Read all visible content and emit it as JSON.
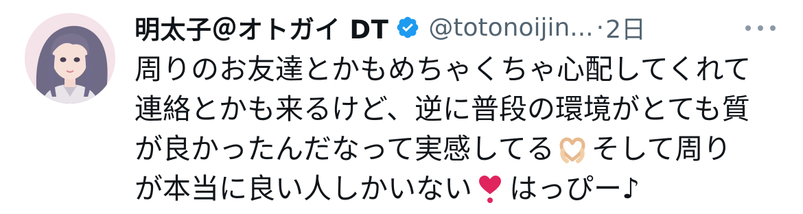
{
  "tweet": {
    "display_name": "明太子＠オトガイ DT",
    "handle": "@totonoijin...",
    "separator": "·",
    "time": "2日",
    "lines": [
      "周りのお友達とかもめちゃくちゃ心配してくれて",
      "連絡とかも来るけど、逆に普段の環境がとても質",
      "が良かったんだなって実感してる",
      "そして周り",
      "が本当に良い人しかいない",
      "はっぴー♪"
    ],
    "icons": {
      "verified": "verified-badge-icon",
      "more": "more-options-icon",
      "emoji_1": "heart-hands-emoji",
      "emoji_2": "red-heart-emoji"
    },
    "colors": {
      "text": "#0f1419",
      "secondary": "#536471",
      "verified": "#1d9bf0",
      "heart": "#e0245e"
    }
  }
}
